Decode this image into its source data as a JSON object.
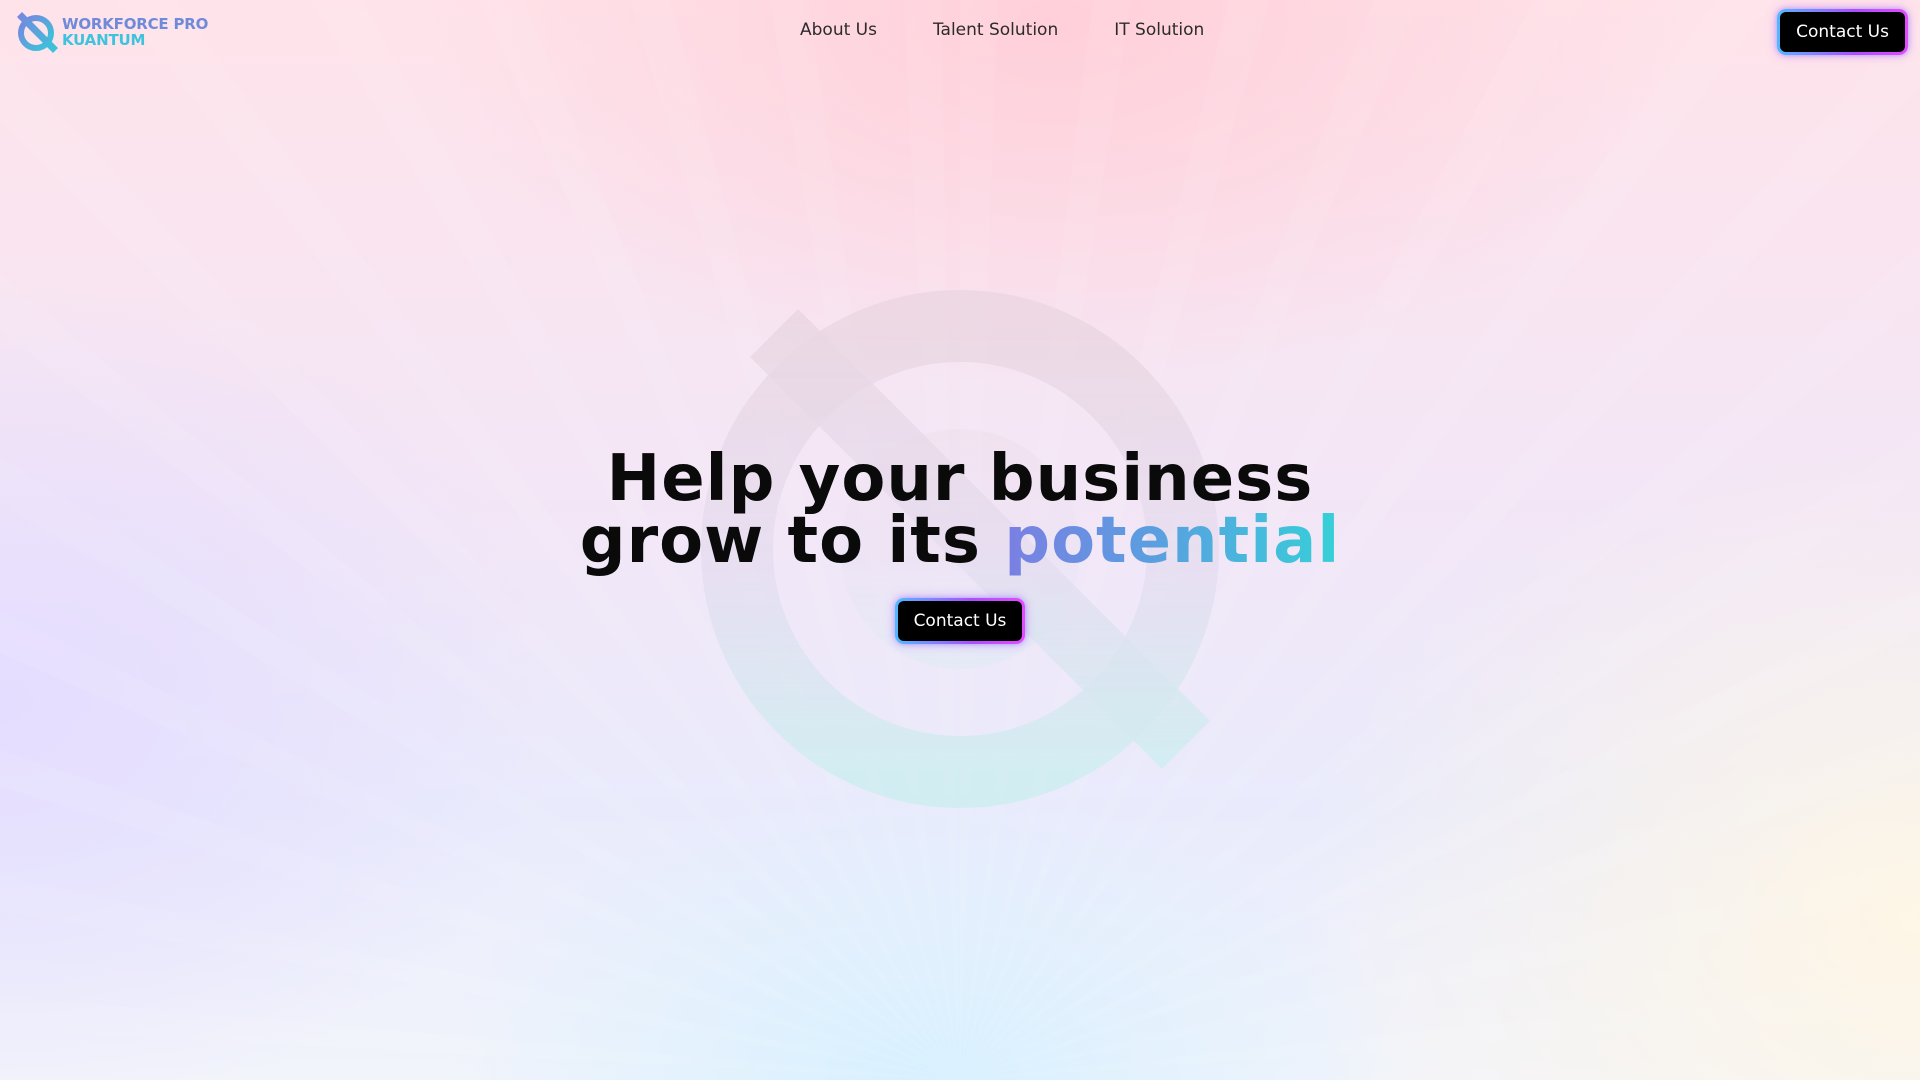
{
  "brand": {
    "line1": "WORKFORCE PRO",
    "line2": "KUANTUM",
    "colors": {
      "primary": "#6f8ad8",
      "secondary": "#3fc3dd"
    }
  },
  "nav": {
    "items": [
      {
        "label": "About Us"
      },
      {
        "label": "Talent Solution"
      },
      {
        "label": "IT Solution"
      }
    ],
    "cta_label": "Contact Us"
  },
  "hero": {
    "line1": "Help your business",
    "line2_prefix": "grow to its",
    "line2_highlight": "potential",
    "cta_label": "Contact Us"
  },
  "colors": {
    "button_bg": "#000000",
    "button_border_start": "#52b8ff",
    "button_border_end": "#e54bff",
    "highlight_start": "#7a7fe2",
    "highlight_end": "#36d0d8"
  },
  "icons": {
    "logo": "q-magnifier-logo-icon",
    "watermark": "q-magnifier-watermark-icon"
  }
}
